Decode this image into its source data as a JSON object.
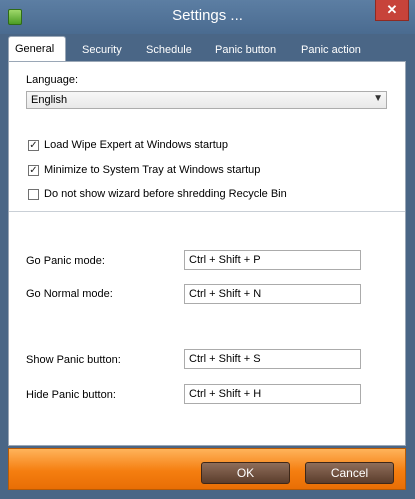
{
  "window": {
    "title": "Settings ...",
    "close_label": "✕"
  },
  "tabs": [
    {
      "label": "General"
    },
    {
      "label": "Security"
    },
    {
      "label": "Schedule"
    },
    {
      "label": "Panic button"
    },
    {
      "label": "Panic action"
    }
  ],
  "general": {
    "language_label": "Language:",
    "language_value": "English",
    "checkboxes": [
      {
        "label": "Load Wipe Expert at Windows startup",
        "checked": true
      },
      {
        "label": "Minimize to System Tray at Windows startup",
        "checked": true
      },
      {
        "label": "Do not show wizard before shredding Recycle Bin",
        "checked": false
      }
    ],
    "shortcuts": [
      {
        "label": "Go Panic mode:",
        "value": "Ctrl + Shift + P"
      },
      {
        "label": "Go Normal mode:",
        "value": "Ctrl + Shift + N"
      },
      {
        "label": "Show Panic button:",
        "value": "Ctrl + Shift + S"
      },
      {
        "label": "Hide Panic button:",
        "value": "Ctrl + Shift + H"
      }
    ]
  },
  "footer": {
    "ok_label": "OK",
    "cancel_label": "Cancel"
  },
  "colors": {
    "frame": "#4a6686",
    "footer": "#f57e10",
    "button": "#6b4a37"
  }
}
